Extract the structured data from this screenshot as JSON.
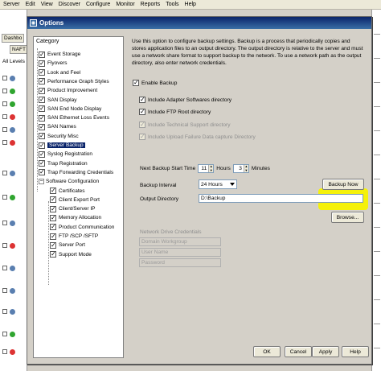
{
  "menu": [
    "Server",
    "Edit",
    "View",
    "Discover",
    "Configure",
    "Monitor",
    "Reports",
    "Tools",
    "Help"
  ],
  "background": {
    "tab1": "Dashbo",
    "tab2": "NAFT",
    "levels_label": "All Levels"
  },
  "dialog": {
    "title": "Options"
  },
  "category": {
    "header": "Category",
    "items": [
      {
        "label": "Event Storage",
        "checked": true
      },
      {
        "label": "Flyovers",
        "checked": true
      },
      {
        "label": "Look and Feel",
        "checked": true
      },
      {
        "label": "Performance Graph Styles",
        "checked": true
      },
      {
        "label": "Product Improvement",
        "checked": true
      },
      {
        "label": "SAN Display",
        "checked": true
      },
      {
        "label": "SAN End Node Display",
        "checked": true
      },
      {
        "label": "SAN Ethernet Loss Events",
        "checked": true
      },
      {
        "label": "SAN Names",
        "checked": true
      },
      {
        "label": "Security Misc",
        "checked": true
      },
      {
        "label": "Server Backup",
        "checked": true,
        "selected": true
      },
      {
        "label": "Syslog Registration",
        "checked": true
      },
      {
        "label": "Trap Registration",
        "checked": true
      },
      {
        "label": "Trap Forwarding Credentials",
        "checked": true
      },
      {
        "label": "Software Configuration",
        "checked": false,
        "folder": true
      },
      {
        "label": "Certificates",
        "checked": true,
        "child": true
      },
      {
        "label": "Client Export Port",
        "checked": true,
        "child": true
      },
      {
        "label": "Client/Server IP",
        "checked": true,
        "child": true
      },
      {
        "label": "Memory Allocation",
        "checked": true,
        "child": true
      },
      {
        "label": "Product Communication",
        "checked": true,
        "child": true
      },
      {
        "label": "FTP /SCP /SFTP",
        "checked": true,
        "child": true
      },
      {
        "label": "Server Port",
        "checked": true,
        "child": true
      },
      {
        "label": "Support Mode",
        "checked": true,
        "child": true
      }
    ]
  },
  "content": {
    "description": "Use this option to configure backup settings. Backup is a process that periodically copies and stores application files to an output directory. The output directory is relative to the server and must use a network share format to support backup to the network. To use a network path as the output directory, also enter network credentials.",
    "enable_backup": "Enable Backup",
    "include_adapter": "Include Adapter Softwares directory",
    "include_ftp": "Include FTP Root directory",
    "include_tech": "Include Technical Support directory",
    "include_upload": "Include Upload Failure Data capture Directory",
    "next_backup_label": "Next Backup Start Time",
    "hours_value": "11",
    "hours_label": "Hours",
    "minutes_value": "3",
    "minutes_label": "Minutes",
    "interval_label": "Backup Interval",
    "interval_value": "24 Hours",
    "backup_now": "Backup Now",
    "output_dir_label": "Output Directory",
    "output_dir_value": "D:\\Backup",
    "browse": "Browse...",
    "network_creds": "Network Drive Credentials",
    "domain_label": "Domain Workgroup",
    "user_label": "User Name",
    "password_label": "Password"
  },
  "buttons": {
    "ok": "OK",
    "cancel": "Cancel",
    "apply": "Apply",
    "help": "Help"
  },
  "colors": {
    "title_bar": "#0a246a",
    "selection": "#0a246a",
    "highlight": "#f7f200"
  }
}
